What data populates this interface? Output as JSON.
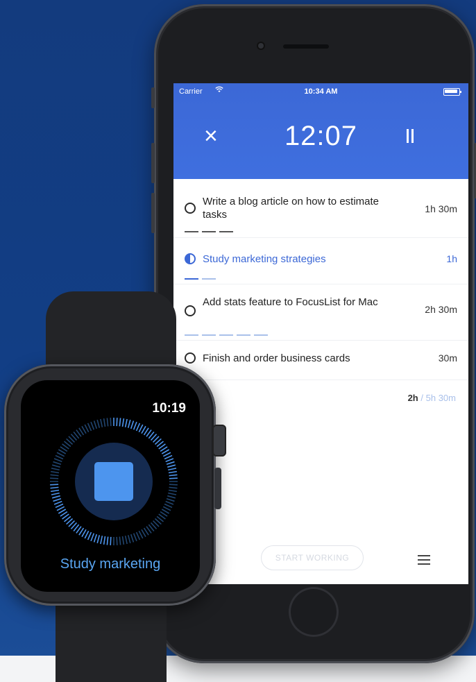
{
  "phone": {
    "status": {
      "carrier": "Carrier",
      "wifi_icon": "wifi-icon",
      "time": "10:34 AM",
      "battery_icon": "battery-icon"
    },
    "header": {
      "close_icon": "close-icon",
      "close_glyph": "×",
      "timer": "12:07",
      "pause_icon": "pause-icon"
    },
    "tasks": [
      {
        "name": "Write a blog article on how to estimate tasks",
        "duration": "1h 30m",
        "state": "todo",
        "pomodoros_total": 3,
        "pomodoros_done": 0
      },
      {
        "name": "Study marketing strategies",
        "duration": "1h",
        "state": "in-progress",
        "pomodoros_total": 2,
        "pomodoros_done": 1
      },
      {
        "name": "Add stats feature to FocusList for Mac",
        "duration": "2h 30m",
        "state": "todo",
        "pomodoros_total": 5,
        "pomodoros_done": 0
      },
      {
        "name": "Finish and order business cards",
        "duration": "30m",
        "state": "todo",
        "pomodoros_total": 1,
        "pomodoros_done": 0
      }
    ],
    "summary": {
      "done": "2h",
      "separator": "/",
      "total": "5h 30m"
    },
    "footer": {
      "start_button": "START WORKING",
      "menu_icon": "menu-icon"
    }
  },
  "watch": {
    "time": "10:19",
    "progress": 0.5,
    "stop_icon": "stop-icon",
    "label": "Study marketing"
  },
  "colors": {
    "background": "#133b7e",
    "header_blue": "#3c68d6",
    "accent_blue": "#4d95ee",
    "watch_label": "#5aa6f2",
    "dash_done": "#3c68d6",
    "dash_todo": "#a9c0ea"
  }
}
